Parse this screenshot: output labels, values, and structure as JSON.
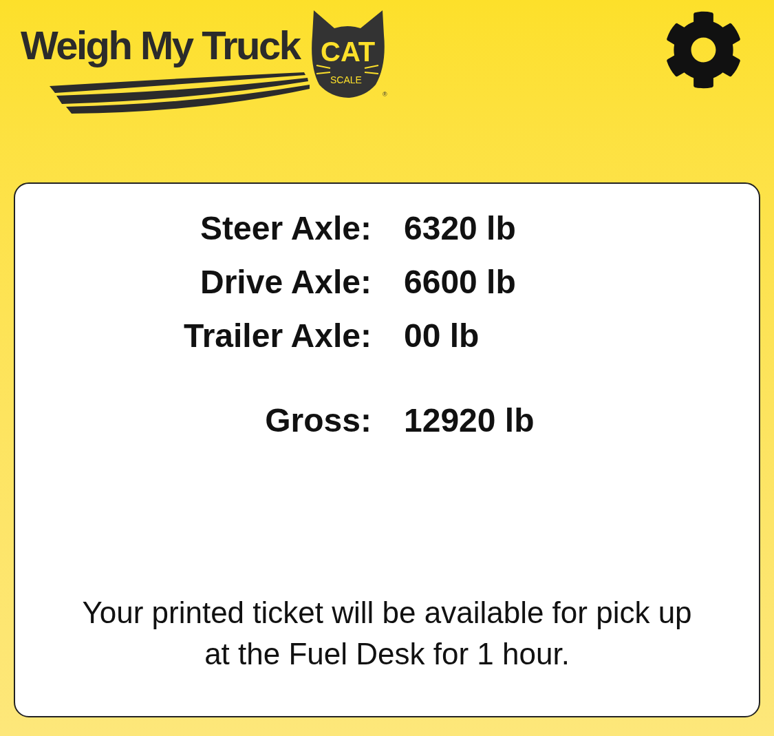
{
  "header": {
    "logo": {
      "title": "Weigh My Truck",
      "badge": "CAT",
      "badge_sub": "SCALE",
      "registered": "®"
    }
  },
  "weights": [
    {
      "label": "Steer Axle:",
      "value": "6320 lb"
    },
    {
      "label": "Drive Axle:",
      "value": "6600 lb"
    },
    {
      "label": "Trailer Axle:",
      "value": "00 lb"
    }
  ],
  "gross": {
    "label": "Gross:",
    "value": "12920 lb"
  },
  "notice": "Your printed ticket will be available for pick up at the Fuel Desk for 1 hour."
}
